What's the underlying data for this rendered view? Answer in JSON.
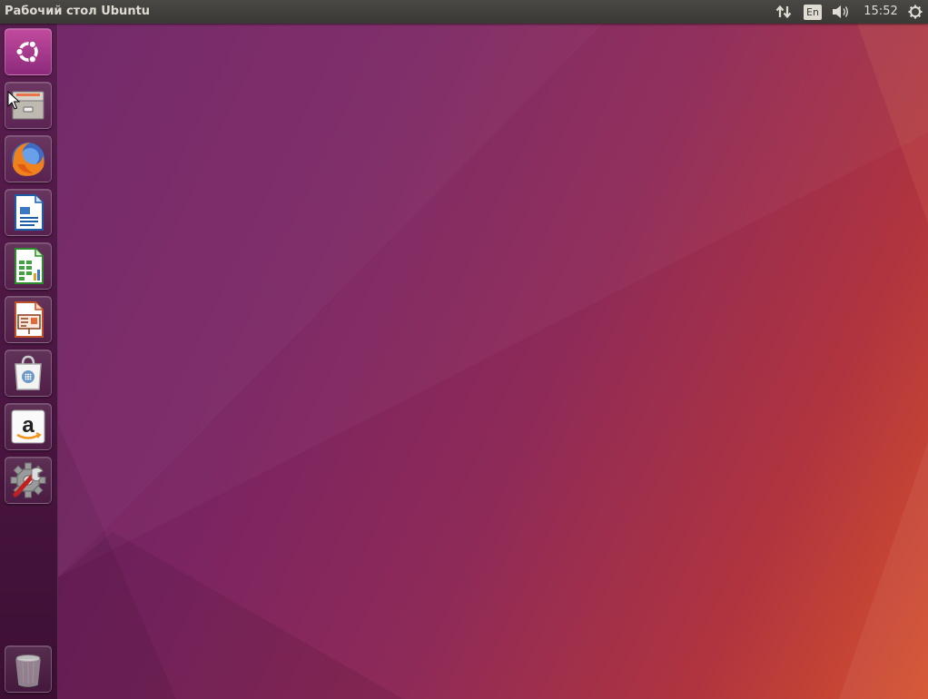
{
  "panel": {
    "title": "Рабочий стол Ubuntu",
    "indicators": {
      "network_icon": "network-updown-icon",
      "keyboard_layout": "En",
      "sound_icon": "speaker-volume-icon",
      "clock": "15:52",
      "power_icon": "power-gear-icon"
    }
  },
  "launcher": {
    "items": [
      {
        "name": "ubuntu-dash",
        "icon": "ubuntu-logo-icon"
      },
      {
        "name": "files",
        "icon": "file-cabinet-icon"
      },
      {
        "name": "firefox",
        "icon": "firefox-icon"
      },
      {
        "name": "libreoffice-writer",
        "icon": "writer-document-icon"
      },
      {
        "name": "libreoffice-calc",
        "icon": "calc-spreadsheet-icon"
      },
      {
        "name": "libreoffice-impress",
        "icon": "impress-presentation-icon"
      },
      {
        "name": "ubuntu-software",
        "icon": "shopping-bag-icon"
      },
      {
        "name": "amazon",
        "icon": "amazon-icon"
      },
      {
        "name": "system-settings",
        "icon": "settings-wrench-gear-icon"
      },
      {
        "name": "trash",
        "icon": "trash-can-icon"
      }
    ]
  },
  "colors": {
    "panel_bg": "#3c3b37",
    "panel_text": "#dfdbd2",
    "launcher_bg": "#4a1540",
    "wallpaper_left": "#6c1f62",
    "wallpaper_right": "#d5502c"
  }
}
